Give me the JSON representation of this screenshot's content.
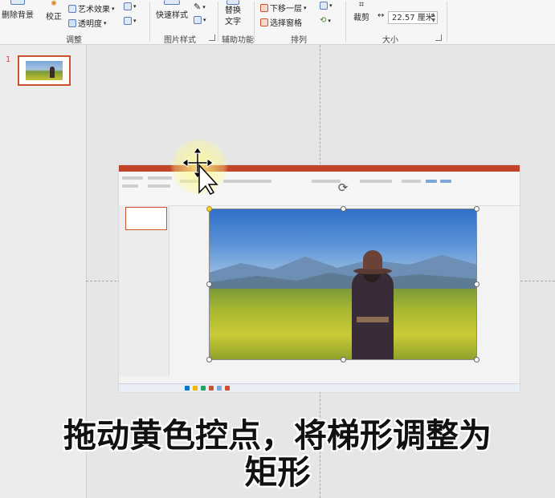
{
  "ribbon": {
    "remove_background": "删除背景",
    "corrections": "校正",
    "artistic_effects": "艺术效果",
    "transparency": "透明度",
    "quick_styles": "快速样式",
    "alt_text_line1": "替换",
    "alt_text_line2": "文字",
    "send_backward": "下移一层",
    "selection_pane": "选择窗格",
    "crop": "裁剪",
    "width_value": "22.57 厘米",
    "groups": {
      "adjust": "调整",
      "picture_styles": "图片样式",
      "accessibility": "辅助功能",
      "arrange": "排列",
      "size": "大小"
    }
  },
  "slides": {
    "current_number": "1"
  },
  "caption": {
    "line1": "拖动黄色控点，将梯形调整为",
    "line2": "矩形"
  },
  "colors": {
    "accent": "#c9542c",
    "adjust_handle": "#f4d03f"
  },
  "icons": [
    "remove-background-icon",
    "corrections-icon",
    "artistic-effects-icon",
    "transparency-icon",
    "quick-styles-icon",
    "alt-text-icon",
    "send-backward-icon",
    "selection-pane-icon",
    "crop-icon",
    "rotate-icon",
    "move-cursor-icon"
  ]
}
